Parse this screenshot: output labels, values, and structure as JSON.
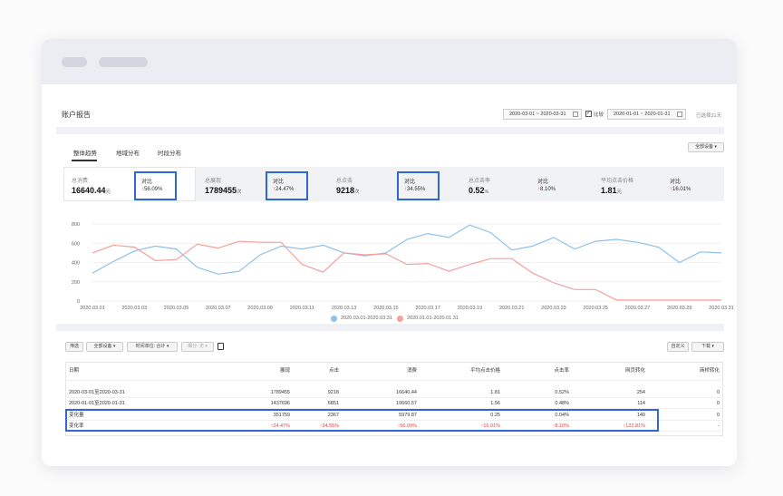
{
  "page": {
    "title": "账户报告"
  },
  "date_range": {
    "primary": "2020-03-01 ~ 2020-03-31",
    "compare_label": "比较",
    "secondary": "2020-01-01 ~ 2020-01-31",
    "selected_info": "已选择31天"
  },
  "tabs": [
    "整体趋势",
    "地域分布",
    "时段分布"
  ],
  "device_filter": "全部设备",
  "kpis": [
    {
      "label": "总消费",
      "value": "16640.44",
      "unit": "元",
      "cmp_label": "对比",
      "cmp_value": "56.09%"
    },
    {
      "label": "总展现",
      "value": "1789455",
      "unit": "次",
      "cmp_label": "对比",
      "cmp_value": "24.47%"
    },
    {
      "label": "总点击",
      "value": "9218",
      "unit": "次",
      "cmp_label": "对比",
      "cmp_value": "34.55%"
    },
    {
      "label": "总点击率",
      "value": "0.52",
      "unit": "%",
      "cmp_label": "对比",
      "cmp_value": "8.10%"
    },
    {
      "label": "平均点击价格",
      "value": "1.81",
      "unit": "元",
      "cmp_label": "对比",
      "cmp_value": "16.01%"
    }
  ],
  "chart_data": {
    "type": "line",
    "x": [
      "2020.03.01",
      "2020.03.02",
      "2020.03.03",
      "2020.03.04",
      "2020.03.05",
      "2020.03.06",
      "2020.03.07",
      "2020.03.08",
      "2020.03.09",
      "2020.03.10",
      "2020.03.11",
      "2020.03.12",
      "2020.03.13",
      "2020.03.14",
      "2020.03.15",
      "2020.03.16",
      "2020.03.17",
      "2020.03.18",
      "2020.03.19",
      "2020.03.20",
      "2020.03.21",
      "2020.03.22",
      "2020.03.23",
      "2020.03.24",
      "2020.03.25",
      "2020.03.26",
      "2020.03.27",
      "2020.03.28",
      "2020.03.29",
      "2020.03.30",
      "2020.03.31"
    ],
    "x_tick_labels": [
      "2020.03.01",
      "2020.03.03",
      "2020.03.05",
      "2020.03.07",
      "2020.03.09",
      "2020.03.11",
      "2020.03.13",
      "2020.03.15",
      "2020.03.17",
      "2020.03.19",
      "2020.03.21",
      "2020.03.23",
      "2020.03.25",
      "2020.03.27",
      "2020.03.29",
      "2020.03.31"
    ],
    "y_ticks": [
      0,
      200,
      400,
      600,
      800
    ],
    "ylim": [
      0,
      800
    ],
    "grid": true,
    "legend_position": "bottom",
    "series": [
      {
        "name": "2020.03.01-2020.03.31",
        "color": "#8ec1ea",
        "values": [
          290,
          410,
          520,
          570,
          540,
          350,
          280,
          310,
          480,
          570,
          540,
          580,
          500,
          470,
          500,
          640,
          700,
          660,
          790,
          710,
          530,
          570,
          660,
          540,
          620,
          640,
          610,
          560,
          400,
          510,
          500
        ]
      },
      {
        "name": "2020.01.01-2020.01.31",
        "color": "#f5a0a0",
        "values": [
          500,
          580,
          560,
          420,
          430,
          590,
          550,
          620,
          610,
          610,
          380,
          300,
          500,
          480,
          490,
          380,
          390,
          310,
          380,
          440,
          440,
          290,
          190,
          120,
          120,
          10,
          10,
          10,
          10,
          10,
          10
        ]
      }
    ]
  },
  "toolbar": {
    "filter": "筛选",
    "device": "全部设备",
    "time_unit": "时间单位: 合计",
    "dimension": "细分: 无",
    "customize": "自定义",
    "download": "下载"
  },
  "table": {
    "headers": [
      "日期",
      "展现",
      "点击",
      "消费",
      "平均点击价格",
      "点击率",
      "网页转化",
      "商桥转化"
    ],
    "rows": [
      [
        "2020-03-01至2020-03-31",
        "1789455",
        "9218",
        "16640.44",
        "1.81",
        "0.52%",
        "254",
        "0"
      ],
      [
        "2020-01-01至2020-01-31",
        "1437696",
        "6851",
        "10660.57",
        "1.56",
        "0.48%",
        "114",
        "0"
      ],
      [
        "变化量",
        "351759",
        "2367",
        "5979.87",
        "0.25",
        "0.04%",
        "140",
        "0"
      ],
      [
        "变化率",
        "24.47%",
        "34.55%",
        "56.09%",
        "16.01%",
        "8.10%",
        "122.81%",
        "-"
      ]
    ]
  },
  "colors": {
    "accent": "#2f67d8",
    "up": "#e8413c"
  }
}
